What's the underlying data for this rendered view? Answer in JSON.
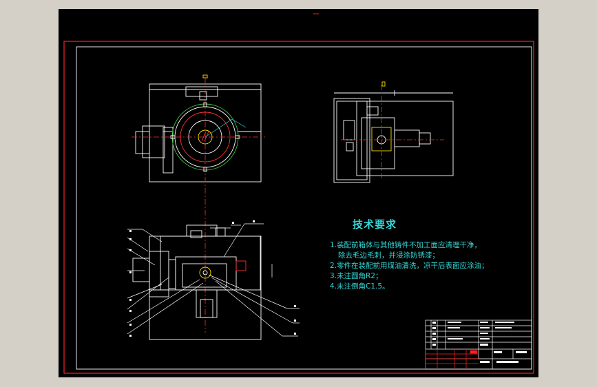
{
  "technical_requirements": {
    "title": "技术要求",
    "items": [
      "1.装配前箱体与其他铸件不加工面应清理干净，",
      "除去毛边毛刺，并浸涂防锈漆；",
      "2.零件在装配前用煤油清洗，凉干后表面应涂油；",
      "3.未注圆角R2；",
      "4.未注倒角C1.5。"
    ]
  },
  "colors": {
    "background": "#000000",
    "window": "#d4d0c8",
    "outer_frame": "#ff2020",
    "inner_frame": "#ffffff",
    "outline": "#ffffff",
    "center_line": "#ff3030",
    "dimension": "#36d6d6",
    "accent": "#ffe000",
    "hidden": "#ff3030"
  }
}
